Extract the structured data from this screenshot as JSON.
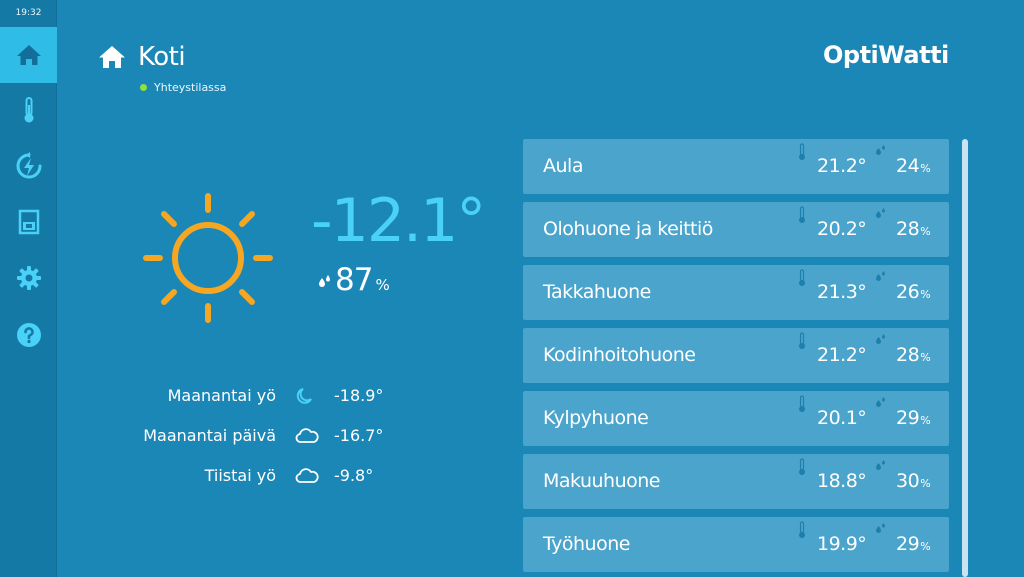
{
  "status_bar": {
    "time": "19:32"
  },
  "sidebar": {
    "items": [
      {
        "icon": "home-icon",
        "active": true
      },
      {
        "icon": "thermometer-icon",
        "active": false
      },
      {
        "icon": "energy-icon",
        "active": false
      },
      {
        "icon": "device-icon",
        "active": false
      },
      {
        "icon": "gear-icon",
        "active": false
      },
      {
        "icon": "help-icon",
        "active": false
      }
    ]
  },
  "header": {
    "title": "Koti",
    "connection_status": "Yhteystilassa",
    "logo": "OptiWatti"
  },
  "weather": {
    "current_temp": "-12.1°",
    "humidity_value": "87",
    "humidity_unit": "%",
    "forecast": [
      {
        "label": "Maanantai yö",
        "icon": "moon-icon",
        "temp": "-18.9°"
      },
      {
        "label": "Maanantai päivä",
        "icon": "cloud-icon",
        "temp": "-16.7°"
      },
      {
        "label": "Tiistai yö",
        "icon": "cloud-icon",
        "temp": "-9.8°"
      }
    ]
  },
  "rooms": [
    {
      "name": "Aula",
      "temp": "21.2°",
      "humidity": "24",
      "unit": "%"
    },
    {
      "name": "Olohuone ja keittiö",
      "temp": "20.2°",
      "humidity": "28",
      "unit": "%"
    },
    {
      "name": "Takkahuone",
      "temp": "21.3°",
      "humidity": "26",
      "unit": "%"
    },
    {
      "name": "Kodinhoitohuone",
      "temp": "21.2°",
      "humidity": "28",
      "unit": "%"
    },
    {
      "name": "Kylpyhuone",
      "temp": "20.1°",
      "humidity": "29",
      "unit": "%"
    },
    {
      "name": "Makuuhuone",
      "temp": "18.8°",
      "humidity": "30",
      "unit": "%"
    },
    {
      "name": "Työhuone",
      "temp": "19.9°",
      "humidity": "29",
      "unit": "%"
    }
  ],
  "colors": {
    "background": "#1b87b6",
    "accent": "#2fbde8",
    "current_temp": "#49d1f7",
    "sun": "#f5a623",
    "online_dot": "#8ee23f"
  }
}
